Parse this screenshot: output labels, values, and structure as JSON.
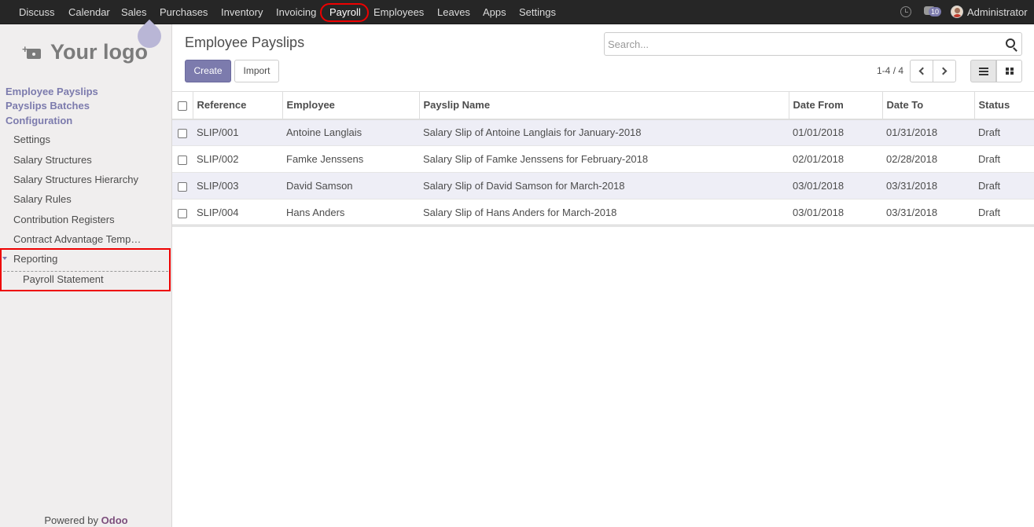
{
  "topbar": {
    "menu": [
      "Discuss",
      "Calendar",
      "Sales",
      "Purchases",
      "Inventory",
      "Invoicing",
      "Payroll",
      "Employees",
      "Leaves",
      "Apps",
      "Settings"
    ],
    "active": "Payroll",
    "chat_count": "10",
    "user": "Administrator"
  },
  "sidebar": {
    "logo_text": "Your logo",
    "heads": [
      "Employee Payslips",
      "Payslips Batches",
      "Configuration"
    ],
    "config_items": [
      "Settings",
      "Salary Structures",
      "Salary Structures Hierarchy",
      "Salary Rules",
      "Contribution Registers",
      "Contract Advantage Temp…"
    ],
    "reporting": "Reporting",
    "reporting_items": [
      "Payroll Statement"
    ],
    "powered_by": "Powered by",
    "powered_brand": "Odoo"
  },
  "control": {
    "title": "Employee Payslips",
    "create_label": "Create",
    "import_label": "Import",
    "search_placeholder": "Search...",
    "pager_value": "1-4",
    "pager_limit": "/ 4"
  },
  "table": {
    "columns": [
      "Reference",
      "Employee",
      "Payslip Name",
      "Date From",
      "Date To",
      "Status"
    ],
    "rows": [
      [
        "SLIP/001",
        "Antoine Langlais",
        "Salary Slip of Antoine Langlais for January-2018",
        "01/01/2018",
        "01/31/2018",
        "Draft"
      ],
      [
        "SLIP/002",
        "Famke Jenssens",
        "Salary Slip of Famke Jenssens for February-2018",
        "02/01/2018",
        "02/28/2018",
        "Draft"
      ],
      [
        "SLIP/003",
        "David Samson",
        "Salary Slip of David Samson for March-2018",
        "03/01/2018",
        "03/31/2018",
        "Draft"
      ],
      [
        "SLIP/004",
        "Hans Anders",
        "Salary Slip of Hans Anders for March-2018",
        "03/01/2018",
        "03/31/2018",
        "Draft"
      ]
    ]
  },
  "colors": {
    "navbar": "#262626",
    "brand": "#7c7bad",
    "highlight": "#e00000"
  }
}
